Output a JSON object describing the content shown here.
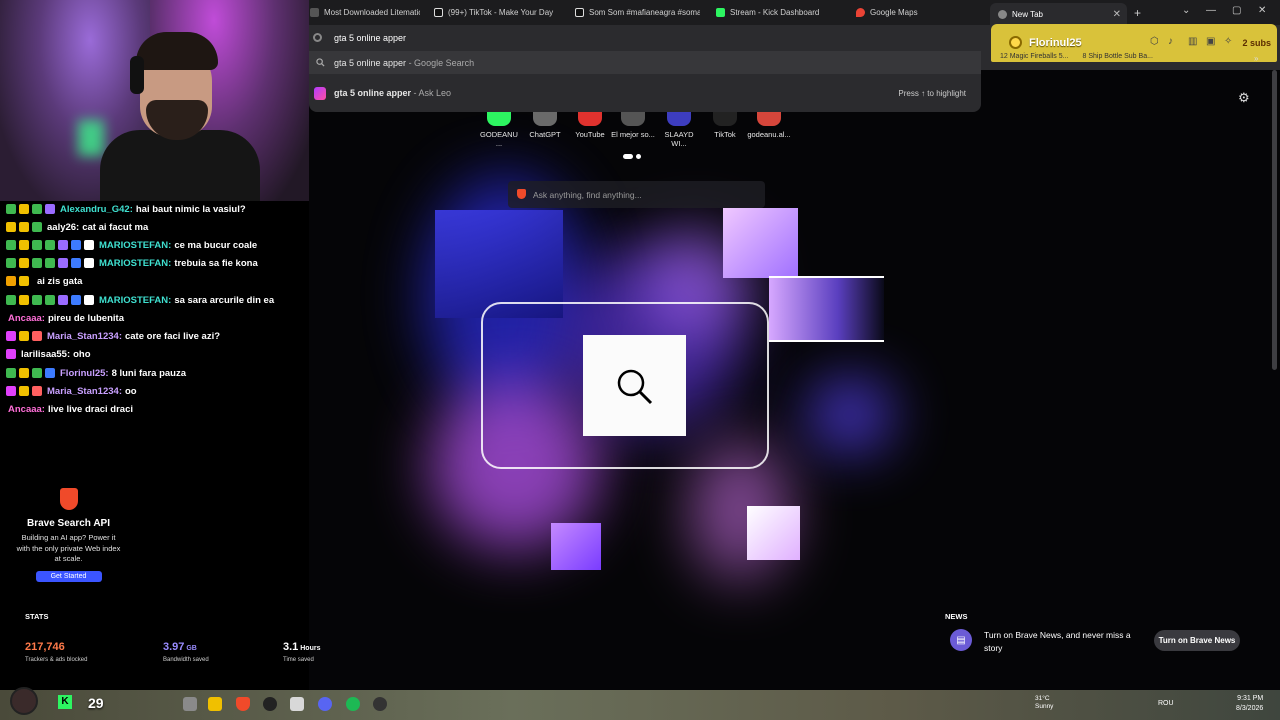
{
  "browser": {
    "tabs": [
      {
        "label": "Most Downloaded Litematica | M",
        "fav_color": "#555555"
      },
      {
        "label": "(99+) TikTok - Make Your Day",
        "fav_color": "#111111"
      },
      {
        "label": "Som Som #mafianeagra #soman",
        "fav_color": "#111111"
      },
      {
        "label": "Stream - Kick Dashboard",
        "fav_color": "#2df561"
      },
      {
        "label": "Google Maps",
        "fav_color": "#ea4335"
      },
      {
        "label": "New Tab",
        "fav_color": "#888888"
      }
    ],
    "new_tab_symbol": "+",
    "close_symbol": "✕"
  },
  "omnibox": {
    "query": "gta 5 online apper",
    "suggestions": [
      {
        "text": "gta 5 online apper",
        "sub": " - Google Search"
      },
      {
        "text": "gta 5 online apper",
        "sub": " - Ask Leo",
        "hint": "Press ↑ to highlight"
      }
    ]
  },
  "sub_alert": {
    "name": "Florinul25",
    "subs": "2 subs"
  },
  "bookmarks": [
    "12 Magic Fireballs 5...",
    "8 Ship Bottle Sub Ba..."
  ],
  "shortcuts": [
    {
      "label": "GODEANU ...",
      "color": "#2df561"
    },
    {
      "label": "ChatGPT",
      "color": "#6a6a6a"
    },
    {
      "label": "YouTube",
      "color": "#e0322e"
    },
    {
      "label": "El mejor so...",
      "color": "#555555"
    },
    {
      "label": "SLAAYD WI...",
      "color": "#3d3dbf"
    },
    {
      "label": "TikTok",
      "color": "#222222"
    },
    {
      "label": "godeanu.al...",
      "color": "#d6463b"
    }
  ],
  "ask": {
    "placeholder": "Ask anything, find anything..."
  },
  "news": {
    "label": "NEWS",
    "text": "Turn on Brave News, and never miss a story",
    "button": "Turn on Brave News"
  },
  "chat": [
    {
      "user": "Alexandru_G42:",
      "user_color": "#3fe0d0",
      "text": "hai baut nimic la vasiul?",
      "badges": [
        "#3fb950",
        "#f0c000",
        "#3fb950",
        "#9a6bff"
      ]
    },
    {
      "user": "aaly26:",
      "user_color": "#ffffff",
      "text": "cat ai facut ma",
      "badges": [
        "#f0c000",
        "#f0c000",
        "#3fb950"
      ]
    },
    {
      "user": "MARIOSTEFAN:",
      "user_color": "#3fe0d0",
      "text": "ce ma bucur coale",
      "badges": [
        "#3fb950",
        "#f0c000",
        "#3fb950",
        "#3fb950",
        "#9a6bff",
        "#3d7bff",
        "#ffffff"
      ]
    },
    {
      "user": "MARIOSTEFAN:",
      "user_color": "#3fe0d0",
      "text": "trebuia sa fie kona",
      "badges": [
        "#3fb950",
        "#f0c000",
        "#3fb950",
        "#3fb950",
        "#9a6bff",
        "#3d7bff",
        "#ffffff"
      ]
    },
    {
      "user": "",
      "user_color": "#ffffff",
      "text": "ai zis gata",
      "badges": [
        "#f0a000",
        "#f0c000"
      ]
    },
    {
      "user": "MARIOSTEFAN:",
      "user_color": "#3fe0d0",
      "text": "sa sara arcurile din ea",
      "badges": [
        "#3fb950",
        "#f0c000",
        "#3fb950",
        "#3fb950",
        "#9a6bff",
        "#3d7bff",
        "#ffffff"
      ]
    },
    {
      "user": "Ancaaa:",
      "user_color": "#ff6fd8",
      "text": "pireu de lubenita",
      "badges": []
    },
    {
      "user": "Maria_Stan1234:",
      "user_color": "#c9a0ff",
      "text": "cate ore faci live azi?",
      "badges": [
        "#e040fb",
        "#f0c000",
        "#ff6060"
      ]
    },
    {
      "user": "larilisaa55:",
      "user_color": "#ffffff",
      "text": "oho",
      "badges": [
        "#e040fb"
      ]
    },
    {
      "user": "Florinul25:",
      "user_color": "#c9a0ff",
      "text": "8 luni fara pauza",
      "badges": [
        "#3fb950",
        "#f0c000",
        "#3fb950",
        "#3d7bff"
      ]
    },
    {
      "user": "Maria_Stan1234:",
      "user_color": "#c9a0ff",
      "text": "oo",
      "badges": [
        "#e040fb",
        "#f0c000",
        "#ff6060"
      ]
    },
    {
      "user": "Ancaaa:",
      "user_color": "#ff6fd8",
      "text": "live live draci draci",
      "badges": []
    }
  ],
  "api_promo": {
    "title": "Brave Search API",
    "desc": "Building an AI app? Power it with the only private Web index at scale.",
    "button": "Get Started"
  },
  "stats": {
    "label": "STATS",
    "items": [
      {
        "value": "217,746",
        "unit": "",
        "label": "Trackers & ads blocked",
        "color": "#ff7a4a"
      },
      {
        "value": "3.97",
        "unit": " GB",
        "label": "Bandwidth saved",
        "color": "#9a8cff"
      },
      {
        "value": "3.1",
        "unit": " Hours",
        "label": "Time saved",
        "color": "#ffffff"
      }
    ]
  },
  "overlay": {
    "count": "29",
    "k": "K"
  },
  "tray": {
    "temp": "31°C",
    "weather": "Sunny",
    "lang": "ROU",
    "time": "9:31 PM",
    "date": "8/3/2026"
  }
}
